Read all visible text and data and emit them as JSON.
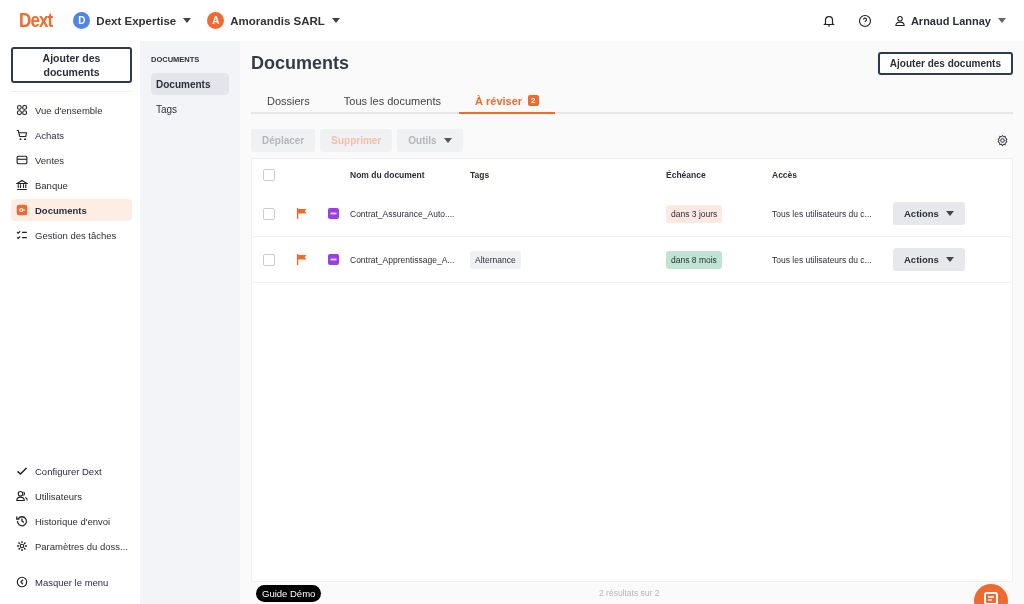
{
  "header": {
    "logo": "Dext",
    "accounts": [
      {
        "initial": "D",
        "name": "Dext Expertise",
        "color": "#4f86e6"
      },
      {
        "initial": "A",
        "name": "Amorandis SARL",
        "color": "#ef6a2e"
      }
    ],
    "user": "Arnaud Lannay"
  },
  "sidebar": {
    "add_button": "Ajouter des documents",
    "items": [
      {
        "kind": "overview",
        "label": "Vue d'ensemble",
        "selected": false
      },
      {
        "kind": "cart",
        "label": "Achats",
        "selected": false
      },
      {
        "kind": "card",
        "label": "Ventes",
        "selected": false
      },
      {
        "kind": "bank",
        "label": "Banque",
        "selected": false
      },
      {
        "kind": "docs",
        "label": "Documents",
        "selected": true
      },
      {
        "kind": "tasks",
        "label": "Gestion des tâches",
        "selected": false
      }
    ],
    "footer_items": [
      {
        "kind": "check",
        "label": "Configurer Dext"
      },
      {
        "kind": "users",
        "label": "Utilisateurs"
      },
      {
        "kind": "history",
        "label": "Historique d'envoi"
      },
      {
        "kind": "gear",
        "label": "Paramètres du doss..."
      }
    ],
    "collapse": "Masquer le menu"
  },
  "subnav": {
    "heading": "DOCUMENTS",
    "items": [
      {
        "label": "Documents",
        "selected": true
      },
      {
        "label": "Tags",
        "selected": false
      }
    ]
  },
  "page": {
    "title": "Documents",
    "add_button": "Ajouter des documents",
    "tabs": [
      {
        "label": "Dossiers",
        "selected": false
      },
      {
        "label": "Tous les documents",
        "selected": false
      },
      {
        "label": "À réviser",
        "badge": "2",
        "selected": true
      }
    ],
    "toolbar": [
      {
        "kind": "plain",
        "label": "Déplacer",
        "disabled": true
      },
      {
        "kind": "danger",
        "label": "Supprimer",
        "disabled": true
      },
      {
        "kind": "menu",
        "label": "Outils",
        "disabled": true
      }
    ],
    "table": {
      "header_checked": false,
      "columns": [
        "Nom du document",
        "Tags",
        "Échéance",
        "Accès"
      ],
      "rows": [
        {
          "checked": false,
          "flagged": true,
          "name": "Contrat_Assurance_Auto....",
          "due": "dans 3 jours",
          "color": "#fde9e1",
          "access": "Tous les utilisateurs du c...",
          "action": "Actions"
        },
        {
          "checked": false,
          "flagged": true,
          "name": "Contrat_Apprentissage_A...",
          "tag": "Alternance",
          "due": "dans 8 mois",
          "color": "#bfe4d4",
          "access": "Tous les utilisateurs du c...",
          "action": "Actions"
        }
      ]
    },
    "results": "2 résultats sur 2",
    "guide": "Guide Démo"
  }
}
